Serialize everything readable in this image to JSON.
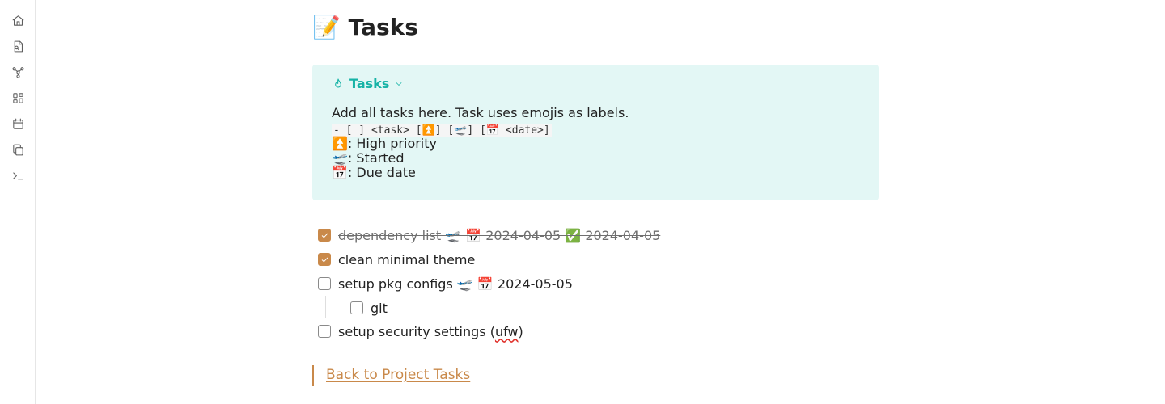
{
  "ribbon": {
    "icons": [
      "home-icon",
      "file-search-icon",
      "graph-icon",
      "layout-grid-icon",
      "calendar-icon",
      "copy-icon",
      "terminal-icon"
    ]
  },
  "page": {
    "title_emoji": "📝",
    "title": "Tasks"
  },
  "callout": {
    "icon": "flame-icon",
    "title": "Tasks",
    "line1": "Add all tasks here. Task uses emojis as labels.",
    "format": "- [ ] <task> [⏫] [🛫] [📅 <date>]",
    "legend": [
      {
        "emoji": "⏫",
        "text": ": High priority"
      },
      {
        "emoji": "🛫",
        "text": ": Started"
      },
      {
        "emoji": "📅",
        "text": ": Due date"
      }
    ]
  },
  "tasks": [
    {
      "text": "dependency list 🛫 📅 2024-04-05 ✅ 2024-04-05",
      "checked": true
    },
    {
      "text": "clean minimal theme",
      "checked": true
    },
    {
      "text": "setup pkg configs 🛫 📅 2024-05-05",
      "checked": false
    },
    {
      "text": "git",
      "checked": false
    },
    {
      "text_before": "setup security settings (",
      "text_flagged": "ufw",
      "text_after": ")",
      "checked": false
    }
  ],
  "footer": {
    "back_link": "Back to Project Tasks"
  },
  "colors": {
    "accent": "#c9894a",
    "callout_bg": "#e3f7f5",
    "callout_title": "#16b3a6"
  }
}
